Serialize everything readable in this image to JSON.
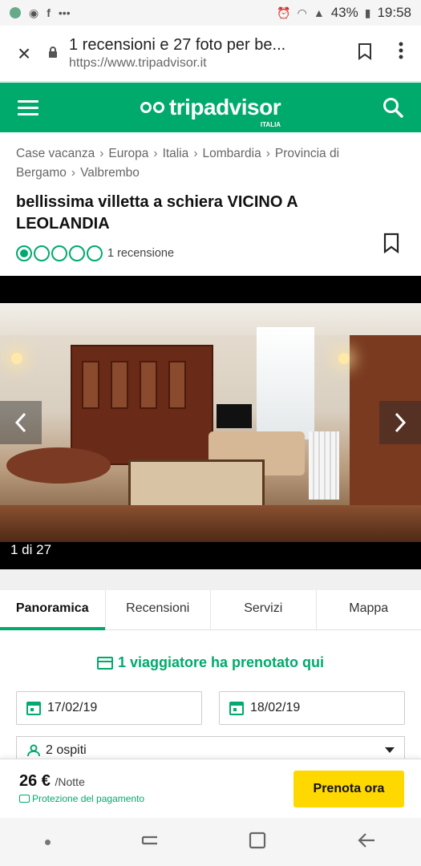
{
  "status_bar": {
    "battery": "43%",
    "time": "19:58",
    "more": "•••"
  },
  "browser": {
    "close": "×",
    "page_title": "1 recensioni e 27 foto per be...",
    "url": "https://www.tripadvisor.it"
  },
  "header": {
    "brand": "tripadvisor",
    "country": "ITALIA"
  },
  "breadcrumb": [
    "Case vacanza",
    "Europa",
    "Italia",
    "Lombardia",
    "Provincia di Bergamo",
    "Valbrembo"
  ],
  "listing": {
    "title": "bellissima villetta a schiera VICINO A LEOLANDIA",
    "rating_bubbles": 1,
    "rating_max": 5,
    "reviews": "1 recensione"
  },
  "gallery": {
    "counter": "1 di 27"
  },
  "tabs": [
    "Panoramica",
    "Recensioni",
    "Servizi",
    "Mappa"
  ],
  "booking": {
    "booked_text": "1 viaggiatore ha prenotato qui",
    "checkin": "17/02/19",
    "checkout": "18/02/19",
    "guests": "2 ospiti"
  },
  "bookbar": {
    "price": "26 €",
    "per": "/Notte",
    "protection": "Protezione del pagamento",
    "cta": "Prenota ora"
  },
  "colors": {
    "brand_green": "#00aa6c",
    "cta_yellow": "#ffd800"
  }
}
